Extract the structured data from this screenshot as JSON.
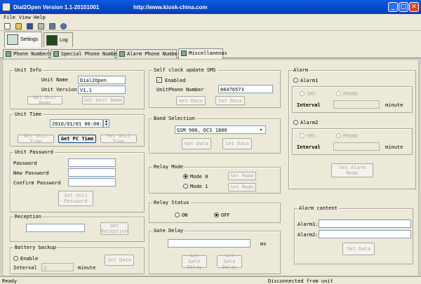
{
  "window": {
    "title": "Dial2Open Version 1.1-20101001",
    "url": "http://www.kiosk-china.com",
    "min": "_",
    "max": "□",
    "close": "✕"
  },
  "menu": {
    "file": "File",
    "view": "View",
    "help": "Help"
  },
  "toolbar": {
    "icons": [
      "new-icon",
      "open-icon",
      "save-icon",
      "print-icon",
      "settings-icon",
      "globe-icon"
    ]
  },
  "bigtabs": {
    "settings": "Settings",
    "log": "Log"
  },
  "tabs": {
    "phone_numbers": "Phone Numbers",
    "special_phone_numbers": "Special Phone Numbers",
    "alarm_phone_numbers": "Alarm Phone Numbers",
    "miscellaneous": "Miscellaneous"
  },
  "unit_info": {
    "title": "Unit Info",
    "name_label": "Unit Name",
    "name_value": "Dial2Open",
    "version_label": "Unit Version",
    "version_value": "V1.1",
    "get_name": "Get Unit Name",
    "set_name": "Set Unit Name"
  },
  "unit_time": {
    "title": "Unit Time",
    "value": "2010/01/01 00:00:00",
    "get": "Get Unit Time",
    "get_pc": "Get PC Time",
    "set": "Set Unit Time"
  },
  "unit_password": {
    "title": "Unit Password",
    "password": "Password",
    "new_password": "New Password",
    "confirm": "Confirm Password",
    "set": "Set Unit Password"
  },
  "reception": {
    "title": "Reception",
    "get": "Get Reception"
  },
  "battery": {
    "title": "Battery backup",
    "enable": "Enable",
    "interval": "Interval",
    "interval_value": "1",
    "unit": "minute",
    "set": "Set Data"
  },
  "self_clock": {
    "title": "Self clock update SMS",
    "enabled": "Enabled",
    "number_label": "UnitPhone Number",
    "number_value": "86476573",
    "get": "Get Data",
    "set": "Set Data"
  },
  "band": {
    "title": "Band Selection",
    "value": "GSM 900, DCS 1800",
    "get": "Get Data",
    "set": "Set Data"
  },
  "relay_mode": {
    "title": "Relay Mode",
    "mode0": "Mode 0",
    "mode1": "Mode 1",
    "set1": "Set Mode",
    "set2": "Set Mode"
  },
  "relay_status": {
    "title": "Relay Status",
    "on": "ON",
    "off": "OFF"
  },
  "gate_delay": {
    "title": "Gate Delay",
    "unit": "ms",
    "get": "Get Gate Delay",
    "set": "Set Gate Delay"
  },
  "alarm": {
    "title": "Alarm",
    "alarm1": "Alarm1",
    "alarm2": "Alarm2",
    "sms": "SMS",
    "phone": "PHONE",
    "interval": "Interval",
    "minute": "minute",
    "set": "Set Alarm Mode"
  },
  "alarm_content": {
    "title": "Alarm content",
    "alarm1": "Alarm1:",
    "alarm2": "Alarm2:",
    "set": "Set Data"
  },
  "status": {
    "left": "Ready",
    "right": "Disconnected from unit"
  }
}
